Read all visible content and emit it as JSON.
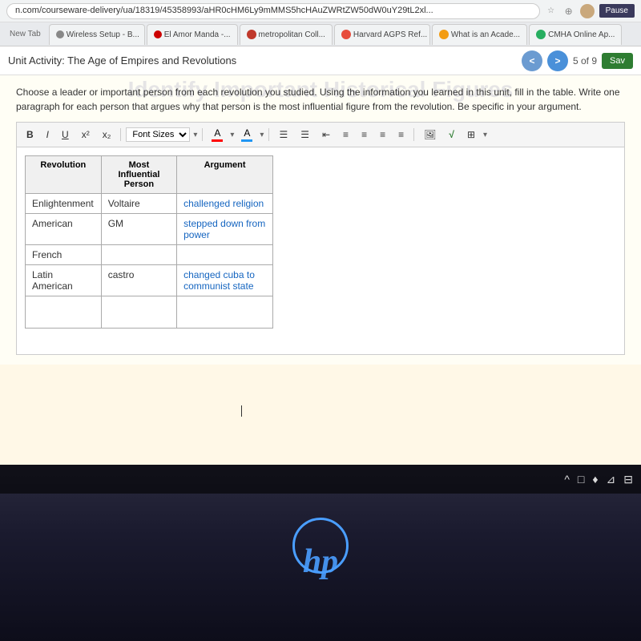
{
  "browser": {
    "address_url": "n.com/courseware-delivery/ua/18319/45358993/aHR0cHM6Ly9mMMS5hcHAuZWRtZW50dW0uY29tL2xl...",
    "tabs": [
      {
        "id": "new-tab",
        "label": "New Tab",
        "color": ""
      },
      {
        "id": "wireless",
        "label": "Wireless Setup - B...",
        "color": "#b0b0b0",
        "dot_color": "#888"
      },
      {
        "id": "amor",
        "label": "El Amor Manda -...",
        "color": "#e00",
        "dot_color": "#cc0000"
      },
      {
        "id": "metropolitan",
        "label": "metropolitan Coll...",
        "color": "#c0392b",
        "dot_color": "#c0392b"
      },
      {
        "id": "harvard",
        "label": "Harvard AGPS Ref...",
        "color": "#e74c3c",
        "dot_color": "#e74c3c"
      },
      {
        "id": "academy",
        "label": "What is an Acade...",
        "color": "#f39c12",
        "dot_color": "#f39c12"
      },
      {
        "id": "cmha",
        "label": "CMHA Online Ap...",
        "color": "#27ae60",
        "dot_color": "#27ae60"
      }
    ],
    "pause_label": "Pause"
  },
  "page": {
    "unit_title": "Unit Activity: The Age of Empires and Revolutions",
    "section_watermark": "Identify Important Historical Figures",
    "nav_current": "5",
    "nav_total": "9",
    "save_label": "Sav",
    "prev_label": "<",
    "next_label": ">"
  },
  "instructions": {
    "text": "Choose a leader or important person from each revolution you studied. Using the information you learned in this unit, fill in the table. Write one paragraph for each person that argues why that person is the most influential figure from the revolution. Be specific in your argument."
  },
  "toolbar": {
    "bold": "B",
    "italic": "I",
    "underline": "U",
    "superscript": "x²",
    "subscript": "x₂",
    "font_size_label": "Font Sizes",
    "font_size_arrow": "▾",
    "text_color_label": "A",
    "highlight_label": "A",
    "list_ul": "≡",
    "list_ol": "≡",
    "indent_less": "⇤",
    "align_left": "≡",
    "align_center": "≡",
    "align_right": "≡",
    "image_icon": "🖼",
    "formula_icon": "√",
    "table_icon": "⊞"
  },
  "table": {
    "headers": [
      "Revolution",
      "Most Influential Person",
      "Argument"
    ],
    "rows": [
      {
        "revolution": "Enlightenment",
        "person": "Voltaire",
        "argument": "challenged religion",
        "arg_blue": true
      },
      {
        "revolution": "American",
        "person": "GM",
        "argument": "stepped down from power",
        "arg_blue": true
      },
      {
        "revolution": "French",
        "person": "",
        "argument": "",
        "arg_blue": false
      },
      {
        "revolution": "Latin American",
        "person": "castro",
        "argument": "changed cuba to communist state",
        "arg_blue": true
      },
      {
        "revolution": "",
        "person": "",
        "argument": "",
        "arg_blue": false
      }
    ]
  },
  "taskbar": {
    "hp_logo": "hp",
    "icons": [
      "^",
      "□",
      "♦",
      "⊿",
      "⊟"
    ]
  }
}
